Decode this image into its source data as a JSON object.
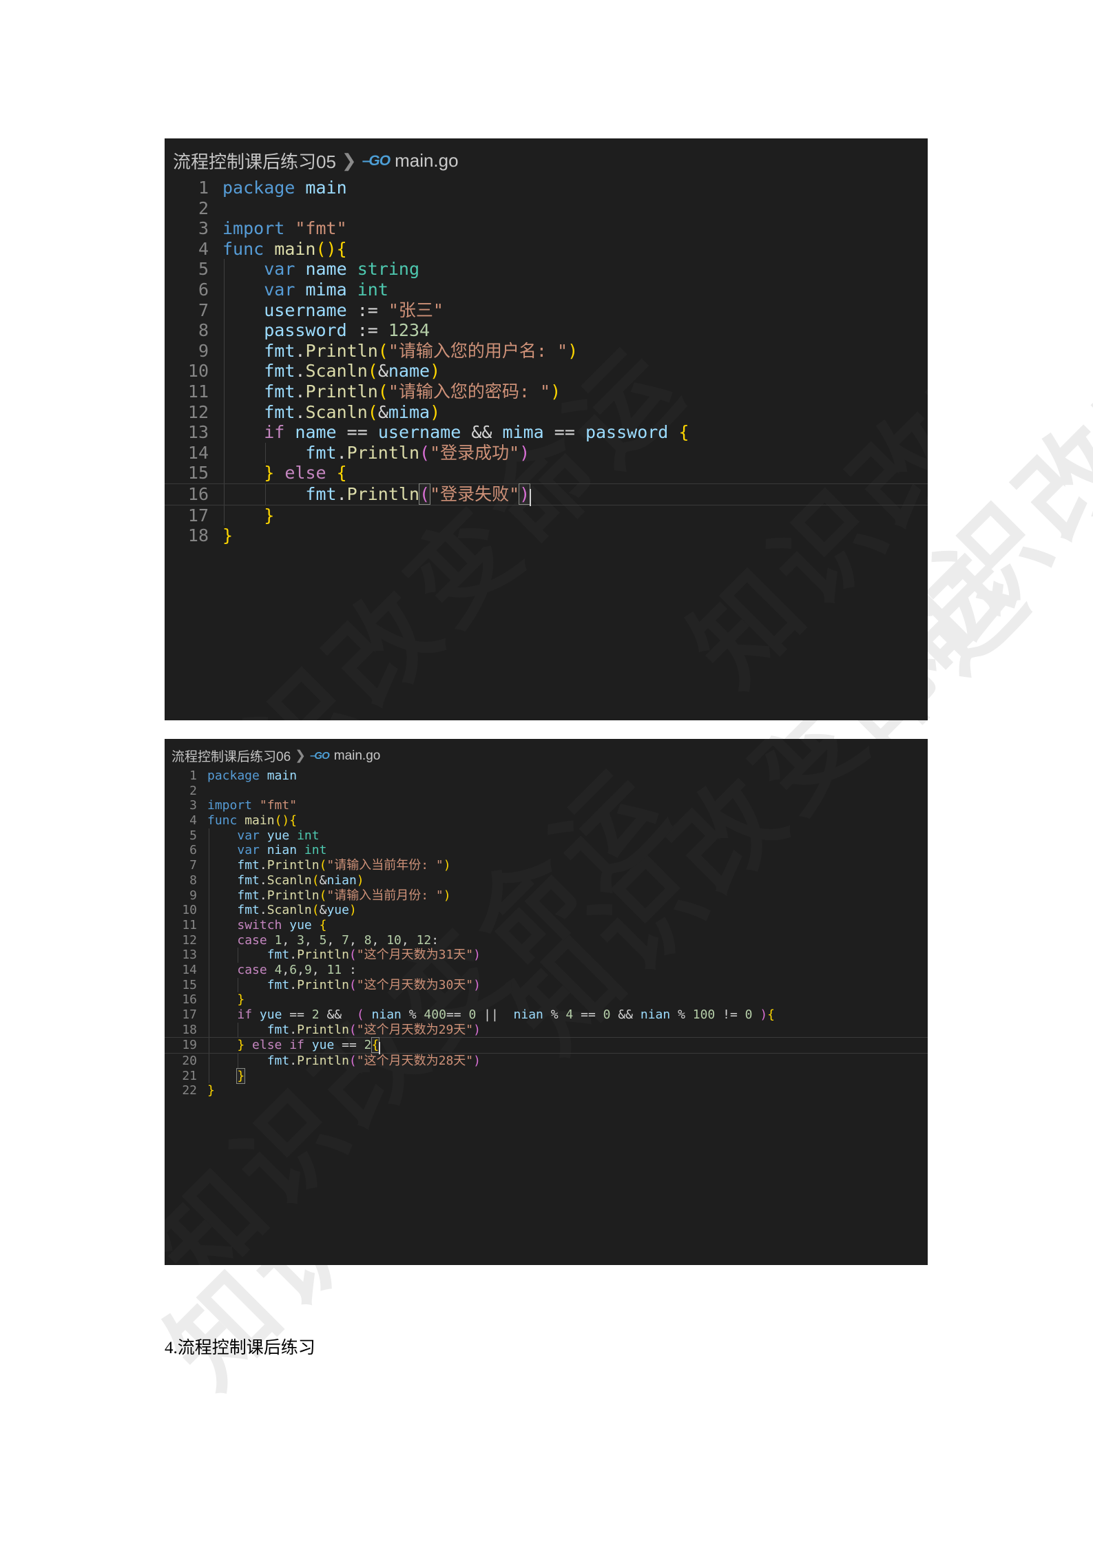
{
  "document": {
    "caption": "4.流程控制课后练习",
    "watermark_text": "知识改变命运"
  },
  "blocks": [
    {
      "id": "code-block-1",
      "breadcrumb": {
        "folder": "流程控制课后练习05",
        "separator": "❯",
        "file_icon": "go-language-icon",
        "file": "main.go"
      },
      "language": "go",
      "current_line": 16,
      "lines": [
        {
          "n": "1",
          "text": "package main"
        },
        {
          "n": "2",
          "text": ""
        },
        {
          "n": "3",
          "text": "import \"fmt\""
        },
        {
          "n": "4",
          "text": "func main(){"
        },
        {
          "n": "5",
          "text": "    var name string"
        },
        {
          "n": "6",
          "text": "    var mima int"
        },
        {
          "n": "7",
          "text": "    username := \"张三\""
        },
        {
          "n": "8",
          "text": "    password := 1234"
        },
        {
          "n": "9",
          "text": "    fmt.Println(\"请输入您的用户名: \")"
        },
        {
          "n": "10",
          "text": "    fmt.Scanln(&name)"
        },
        {
          "n": "11",
          "text": "    fmt.Println(\"请输入您的密码: \")"
        },
        {
          "n": "12",
          "text": "    fmt.Scanln(&mima)"
        },
        {
          "n": "13",
          "text": "    if name == username && mima == password {"
        },
        {
          "n": "14",
          "text": "        fmt.Println(\"登录成功\")"
        },
        {
          "n": "15",
          "text": "    } else {"
        },
        {
          "n": "16",
          "text": "        fmt.Println(\"登录失败\")"
        },
        {
          "n": "17",
          "text": "    }"
        },
        {
          "n": "18",
          "text": "}"
        }
      ]
    },
    {
      "id": "code-block-2",
      "breadcrumb": {
        "folder": "流程控制课后练习06",
        "separator": "❯",
        "file_icon": "go-language-icon",
        "file": "main.go"
      },
      "language": "go",
      "current_line": 19,
      "lines": [
        {
          "n": "1",
          "text": "package main"
        },
        {
          "n": "2",
          "text": ""
        },
        {
          "n": "3",
          "text": "import \"fmt\""
        },
        {
          "n": "4",
          "text": "func main(){"
        },
        {
          "n": "5",
          "text": "    var yue int"
        },
        {
          "n": "6",
          "text": "    var nian int"
        },
        {
          "n": "7",
          "text": "    fmt.Println(\"请输入当前年份: \")"
        },
        {
          "n": "8",
          "text": "    fmt.Scanln(&nian)"
        },
        {
          "n": "9",
          "text": "    fmt.Println(\"请输入当前月份: \")"
        },
        {
          "n": "10",
          "text": "    fmt.Scanln(&yue)"
        },
        {
          "n": "11",
          "text": "    switch yue {"
        },
        {
          "n": "12",
          "text": "    case 1, 3, 5, 7, 8, 10, 12:"
        },
        {
          "n": "13",
          "text": "        fmt.Println(\"这个月天数为31天\")"
        },
        {
          "n": "14",
          "text": "    case 4,6,9, 11 :"
        },
        {
          "n": "15",
          "text": "        fmt.Println(\"这个月天数为30天\")"
        },
        {
          "n": "16",
          "text": "    }"
        },
        {
          "n": "17",
          "text": "    if yue == 2 &&  ( nian % 400== 0 ||  nian % 4 == 0 && nian % 100 != 0 ){"
        },
        {
          "n": "18",
          "text": "        fmt.Println(\"这个月天数为29天\")"
        },
        {
          "n": "19",
          "text": "    } else if yue == 2{"
        },
        {
          "n": "20",
          "text": "        fmt.Println(\"这个月天数为28天\")"
        },
        {
          "n": "21",
          "text": "    }"
        },
        {
          "n": "22",
          "text": "}"
        }
      ]
    }
  ],
  "colors": {
    "editor_background": "#1e1e1e",
    "line_number": "#858585",
    "keyword": "#569cd6",
    "control_keyword": "#c586c0",
    "identifier": "#9cdcfe",
    "function": "#dcdcaa",
    "type": "#4ec9b0",
    "string": "#ce9178",
    "number": "#b5cea8",
    "punctuation": "#d4d4d4",
    "page_background": "#ffffff"
  }
}
